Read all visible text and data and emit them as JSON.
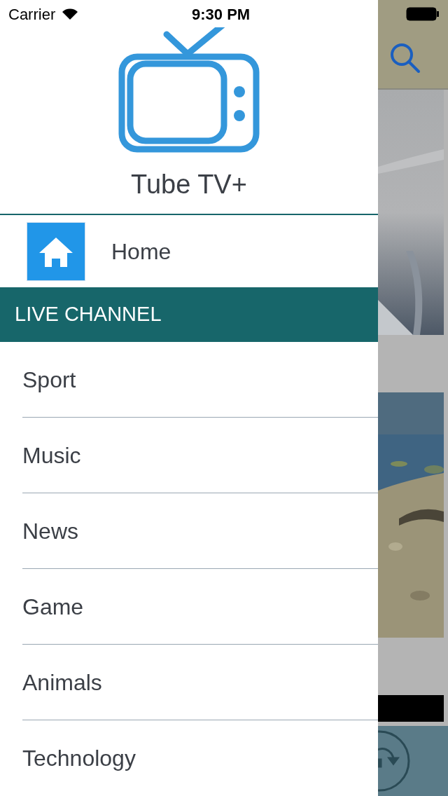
{
  "status_bar": {
    "carrier": "Carrier",
    "time": "9:30 PM"
  },
  "drawer": {
    "app_title": "Tube TV+",
    "home": {
      "label": "Home"
    },
    "section_header": "LIVE CHANNEL",
    "channels": [
      {
        "label": "Sport"
      },
      {
        "label": "Music"
      },
      {
        "label": "News"
      },
      {
        "label": "Game"
      },
      {
        "label": "Animals"
      },
      {
        "label": "Technology"
      }
    ]
  }
}
